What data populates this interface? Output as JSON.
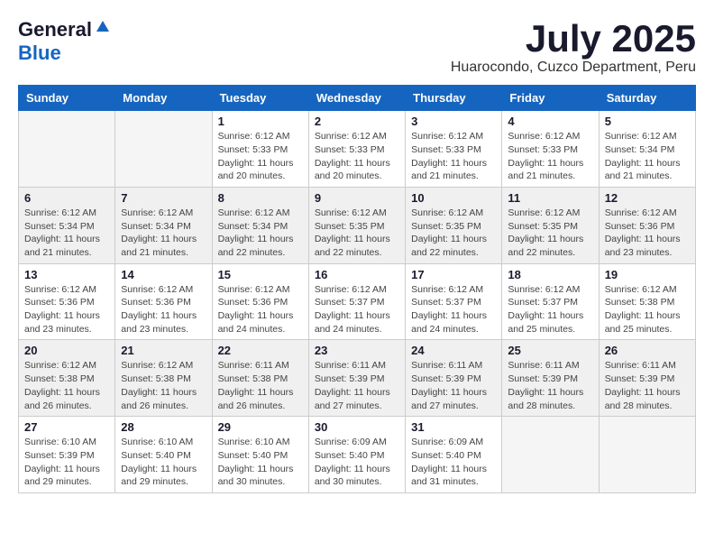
{
  "header": {
    "logo_general": "General",
    "logo_blue": "Blue",
    "month_title": "July 2025",
    "location": "Huarocondo, Cuzco Department, Peru"
  },
  "days_of_week": [
    "Sunday",
    "Monday",
    "Tuesday",
    "Wednesday",
    "Thursday",
    "Friday",
    "Saturday"
  ],
  "weeks": [
    [
      {
        "day": "",
        "empty": true
      },
      {
        "day": "",
        "empty": true
      },
      {
        "day": "1",
        "sunrise": "Sunrise: 6:12 AM",
        "sunset": "Sunset: 5:33 PM",
        "daylight": "Daylight: 11 hours and 20 minutes."
      },
      {
        "day": "2",
        "sunrise": "Sunrise: 6:12 AM",
        "sunset": "Sunset: 5:33 PM",
        "daylight": "Daylight: 11 hours and 20 minutes."
      },
      {
        "day": "3",
        "sunrise": "Sunrise: 6:12 AM",
        "sunset": "Sunset: 5:33 PM",
        "daylight": "Daylight: 11 hours and 21 minutes."
      },
      {
        "day": "4",
        "sunrise": "Sunrise: 6:12 AM",
        "sunset": "Sunset: 5:33 PM",
        "daylight": "Daylight: 11 hours and 21 minutes."
      },
      {
        "day": "5",
        "sunrise": "Sunrise: 6:12 AM",
        "sunset": "Sunset: 5:34 PM",
        "daylight": "Daylight: 11 hours and 21 minutes."
      }
    ],
    [
      {
        "day": "6",
        "sunrise": "Sunrise: 6:12 AM",
        "sunset": "Sunset: 5:34 PM",
        "daylight": "Daylight: 11 hours and 21 minutes."
      },
      {
        "day": "7",
        "sunrise": "Sunrise: 6:12 AM",
        "sunset": "Sunset: 5:34 PM",
        "daylight": "Daylight: 11 hours and 21 minutes."
      },
      {
        "day": "8",
        "sunrise": "Sunrise: 6:12 AM",
        "sunset": "Sunset: 5:34 PM",
        "daylight": "Daylight: 11 hours and 22 minutes."
      },
      {
        "day": "9",
        "sunrise": "Sunrise: 6:12 AM",
        "sunset": "Sunset: 5:35 PM",
        "daylight": "Daylight: 11 hours and 22 minutes."
      },
      {
        "day": "10",
        "sunrise": "Sunrise: 6:12 AM",
        "sunset": "Sunset: 5:35 PM",
        "daylight": "Daylight: 11 hours and 22 minutes."
      },
      {
        "day": "11",
        "sunrise": "Sunrise: 6:12 AM",
        "sunset": "Sunset: 5:35 PM",
        "daylight": "Daylight: 11 hours and 22 minutes."
      },
      {
        "day": "12",
        "sunrise": "Sunrise: 6:12 AM",
        "sunset": "Sunset: 5:36 PM",
        "daylight": "Daylight: 11 hours and 23 minutes."
      }
    ],
    [
      {
        "day": "13",
        "sunrise": "Sunrise: 6:12 AM",
        "sunset": "Sunset: 5:36 PM",
        "daylight": "Daylight: 11 hours and 23 minutes."
      },
      {
        "day": "14",
        "sunrise": "Sunrise: 6:12 AM",
        "sunset": "Sunset: 5:36 PM",
        "daylight": "Daylight: 11 hours and 23 minutes."
      },
      {
        "day": "15",
        "sunrise": "Sunrise: 6:12 AM",
        "sunset": "Sunset: 5:36 PM",
        "daylight": "Daylight: 11 hours and 24 minutes."
      },
      {
        "day": "16",
        "sunrise": "Sunrise: 6:12 AM",
        "sunset": "Sunset: 5:37 PM",
        "daylight": "Daylight: 11 hours and 24 minutes."
      },
      {
        "day": "17",
        "sunrise": "Sunrise: 6:12 AM",
        "sunset": "Sunset: 5:37 PM",
        "daylight": "Daylight: 11 hours and 24 minutes."
      },
      {
        "day": "18",
        "sunrise": "Sunrise: 6:12 AM",
        "sunset": "Sunset: 5:37 PM",
        "daylight": "Daylight: 11 hours and 25 minutes."
      },
      {
        "day": "19",
        "sunrise": "Sunrise: 6:12 AM",
        "sunset": "Sunset: 5:38 PM",
        "daylight": "Daylight: 11 hours and 25 minutes."
      }
    ],
    [
      {
        "day": "20",
        "sunrise": "Sunrise: 6:12 AM",
        "sunset": "Sunset: 5:38 PM",
        "daylight": "Daylight: 11 hours and 26 minutes."
      },
      {
        "day": "21",
        "sunrise": "Sunrise: 6:12 AM",
        "sunset": "Sunset: 5:38 PM",
        "daylight": "Daylight: 11 hours and 26 minutes."
      },
      {
        "day": "22",
        "sunrise": "Sunrise: 6:11 AM",
        "sunset": "Sunset: 5:38 PM",
        "daylight": "Daylight: 11 hours and 26 minutes."
      },
      {
        "day": "23",
        "sunrise": "Sunrise: 6:11 AM",
        "sunset": "Sunset: 5:39 PM",
        "daylight": "Daylight: 11 hours and 27 minutes."
      },
      {
        "day": "24",
        "sunrise": "Sunrise: 6:11 AM",
        "sunset": "Sunset: 5:39 PM",
        "daylight": "Daylight: 11 hours and 27 minutes."
      },
      {
        "day": "25",
        "sunrise": "Sunrise: 6:11 AM",
        "sunset": "Sunset: 5:39 PM",
        "daylight": "Daylight: 11 hours and 28 minutes."
      },
      {
        "day": "26",
        "sunrise": "Sunrise: 6:11 AM",
        "sunset": "Sunset: 5:39 PM",
        "daylight": "Daylight: 11 hours and 28 minutes."
      }
    ],
    [
      {
        "day": "27",
        "sunrise": "Sunrise: 6:10 AM",
        "sunset": "Sunset: 5:39 PM",
        "daylight": "Daylight: 11 hours and 29 minutes."
      },
      {
        "day": "28",
        "sunrise": "Sunrise: 6:10 AM",
        "sunset": "Sunset: 5:40 PM",
        "daylight": "Daylight: 11 hours and 29 minutes."
      },
      {
        "day": "29",
        "sunrise": "Sunrise: 6:10 AM",
        "sunset": "Sunset: 5:40 PM",
        "daylight": "Daylight: 11 hours and 30 minutes."
      },
      {
        "day": "30",
        "sunrise": "Sunrise: 6:09 AM",
        "sunset": "Sunset: 5:40 PM",
        "daylight": "Daylight: 11 hours and 30 minutes."
      },
      {
        "day": "31",
        "sunrise": "Sunrise: 6:09 AM",
        "sunset": "Sunset: 5:40 PM",
        "daylight": "Daylight: 11 hours and 31 minutes."
      },
      {
        "day": "",
        "empty": true
      },
      {
        "day": "",
        "empty": true
      }
    ]
  ]
}
